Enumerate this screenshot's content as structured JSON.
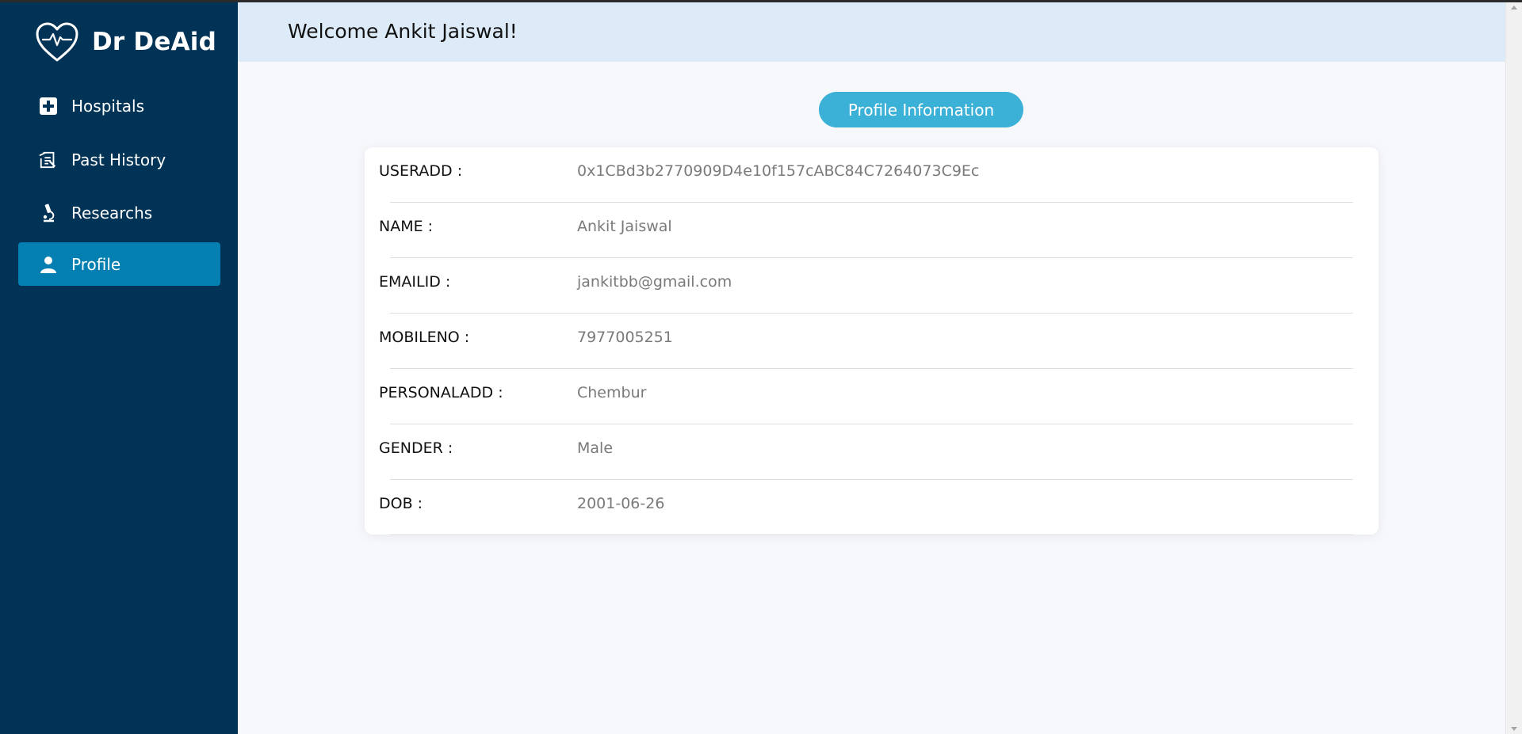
{
  "app": {
    "brand": "Dr DeAid",
    "logo_icon": "heart-pulse-icon"
  },
  "sidebar": {
    "items": [
      {
        "label": "Hospitals",
        "icon": "hospital-plus-icon",
        "active": false
      },
      {
        "label": "Past History",
        "icon": "history-clipboard-icon",
        "active": false
      },
      {
        "label": "Researchs",
        "icon": "microscope-icon",
        "active": false
      },
      {
        "label": "Profile",
        "icon": "user-icon",
        "active": true
      }
    ]
  },
  "header": {
    "welcome": "Welcome Ankit Jaiswal!"
  },
  "main": {
    "section_button": "Profile Information",
    "profile_rows": [
      {
        "label": "USERADD :",
        "value": "0x1CBd3b2770909D4e10f157cABC84C7264073C9Ec"
      },
      {
        "label": "NAME :",
        "value": "Ankit Jaiswal"
      },
      {
        "label": "EMAILID :",
        "value": "jankitbb@gmail.com"
      },
      {
        "label": "MOBILENO :",
        "value": "7977005251"
      },
      {
        "label": "PERSONALADD :",
        "value": "Chembur"
      },
      {
        "label": "GENDER :",
        "value": "Male"
      },
      {
        "label": "DOB :",
        "value": "2001-06-26"
      }
    ]
  },
  "colors": {
    "sidebar_bg": "#013356",
    "active_item": "#037fb1",
    "header_bg": "#ddebf8",
    "pill_bg": "#3bb1d8"
  }
}
